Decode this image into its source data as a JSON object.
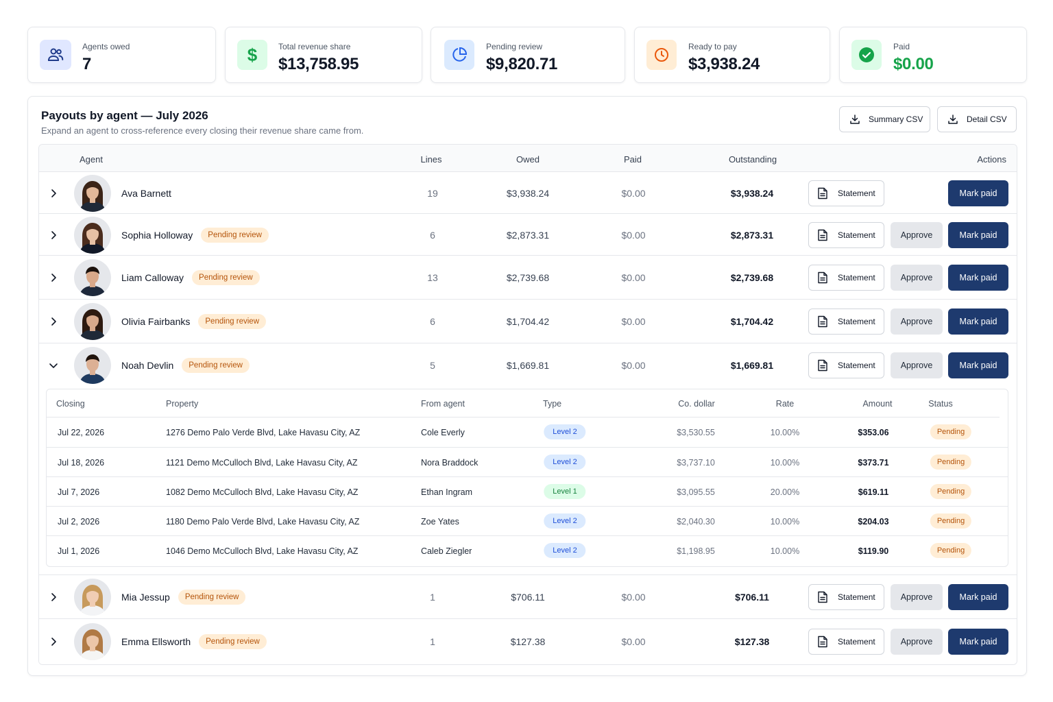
{
  "colors": {
    "primary": "#1e3a6e",
    "paid_value": "#16a34a",
    "pending_bg": "#ffedd5",
    "pending_text": "#b45309"
  },
  "stats": [
    {
      "label": "Agents owed",
      "value": "7",
      "icon": "users-icon"
    },
    {
      "label": "Total revenue share",
      "value": "$13,758.95",
      "icon": "dollar-icon"
    },
    {
      "label": "Pending review",
      "value": "$9,820.71",
      "icon": "pie-chart-icon"
    },
    {
      "label": "Ready to pay",
      "value": "$3,938.24",
      "icon": "clock-icon"
    },
    {
      "label": "Paid",
      "value": "$0.00",
      "icon": "check-circle-icon"
    }
  ],
  "panel": {
    "title": "Payouts by agent — July 2026",
    "subtitle": "Expand an agent to cross-reference every closing their revenue share came from.",
    "summary_csv": "Summary CSV",
    "detail_csv": "Detail CSV"
  },
  "table": {
    "headers": {
      "agent": "Agent",
      "lines": "Lines",
      "owed": "Owed",
      "paid": "Paid",
      "outstanding": "Outstanding",
      "actions": "Actions"
    },
    "statement_label": "Statement",
    "approve_label": "Approve",
    "mark_paid_label": "Mark paid",
    "rows": [
      {
        "name": "Ava Barnett",
        "badge": "",
        "lines": "19",
        "owed": "$3,938.24",
        "paid": "$0.00",
        "outstanding": "$3,938.24",
        "expanded": false
      },
      {
        "name": "Sophia Holloway",
        "badge": "Pending review",
        "lines": "6",
        "owed": "$2,873.31",
        "paid": "$0.00",
        "outstanding": "$2,873.31",
        "expanded": false
      },
      {
        "name": "Liam Calloway",
        "badge": "Pending review",
        "lines": "13",
        "owed": "$2,739.68",
        "paid": "$0.00",
        "outstanding": "$2,739.68",
        "expanded": false
      },
      {
        "name": "Olivia Fairbanks",
        "badge": "Pending review",
        "lines": "6",
        "owed": "$1,704.42",
        "paid": "$0.00",
        "outstanding": "$1,704.42",
        "expanded": false
      },
      {
        "name": "Noah Devlin",
        "badge": "Pending review",
        "lines": "5",
        "owed": "$1,669.81",
        "paid": "$0.00",
        "outstanding": "$1,669.81",
        "expanded": true
      },
      {
        "name": "Mia Jessup",
        "badge": "Pending review",
        "lines": "1",
        "owed": "$706.11",
        "paid": "$0.00",
        "outstanding": "$706.11",
        "expanded": false
      },
      {
        "name": "Emma Ellsworth",
        "badge": "Pending review",
        "lines": "1",
        "owed": "$127.38",
        "paid": "$0.00",
        "outstanding": "$127.38",
        "expanded": false
      }
    ]
  },
  "detail": {
    "headers": {
      "closing": "Closing",
      "property": "Property",
      "from_agent": "From agent",
      "type": "Type",
      "co_dollar": "Co. dollar",
      "rate": "Rate",
      "amount": "Amount",
      "status": "Status"
    },
    "rows": [
      {
        "closing": "Jul 22, 2026",
        "property": "1276 Demo Palo Verde Blvd, Lake Havasu City, AZ",
        "from_agent": "Cole Everly",
        "type": "Level 2",
        "co_dollar": "$3,530.55",
        "rate": "10.00%",
        "amount": "$353.06",
        "status": "Pending"
      },
      {
        "closing": "Jul 18, 2026",
        "property": "1121 Demo McCulloch Blvd, Lake Havasu City, AZ",
        "from_agent": "Nora Braddock",
        "type": "Level 2",
        "co_dollar": "$3,737.10",
        "rate": "10.00%",
        "amount": "$373.71",
        "status": "Pending"
      },
      {
        "closing": "Jul 7, 2026",
        "property": "1082 Demo McCulloch Blvd, Lake Havasu City, AZ",
        "from_agent": "Ethan Ingram",
        "type": "Level 1",
        "co_dollar": "$3,095.55",
        "rate": "20.00%",
        "amount": "$619.11",
        "status": "Pending"
      },
      {
        "closing": "Jul 2, 2026",
        "property": "1180 Demo Palo Verde Blvd, Lake Havasu City, AZ",
        "from_agent": "Zoe Yates",
        "type": "Level 2",
        "co_dollar": "$2,040.30",
        "rate": "10.00%",
        "amount": "$204.03",
        "status": "Pending"
      },
      {
        "closing": "Jul 1, 2026",
        "property": "1046 Demo McCulloch Blvd, Lake Havasu City, AZ",
        "from_agent": "Caleb Ziegler",
        "type": "Level 2",
        "co_dollar": "$1,198.95",
        "rate": "10.00%",
        "amount": "$119.90",
        "status": "Pending"
      }
    ]
  }
}
